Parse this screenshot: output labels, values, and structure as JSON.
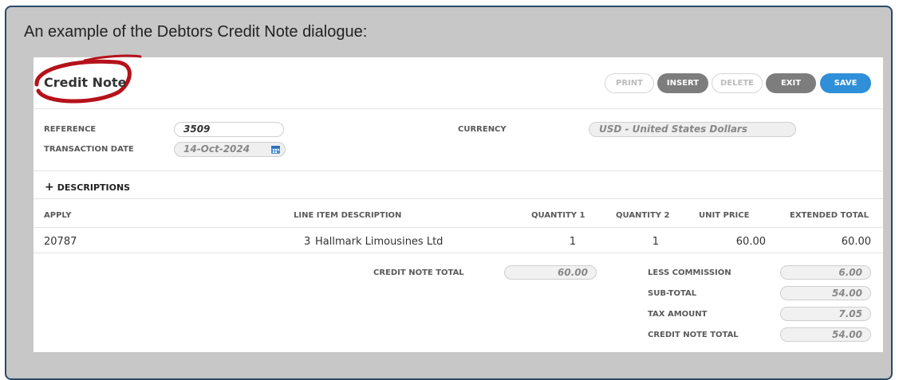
{
  "caption": "An example of the Debtors Credit Note dialogue:",
  "dialog": {
    "title": "Credit Note",
    "buttons": {
      "print": "PRINT",
      "insert": "INSERT",
      "delete": "DELETE",
      "exit": "EXIT",
      "save": "SAVE"
    }
  },
  "form": {
    "reference_label": "REFERENCE",
    "reference_value": "3509",
    "transaction_date_label": "TRANSACTION DATE",
    "transaction_date_value": "14-Oct-2024",
    "currency_label": "CURRENCY",
    "currency_value": "USD - United States Dollars"
  },
  "descriptions_toggle": {
    "icon": "+",
    "label": "DESCRIPTIONS"
  },
  "table": {
    "headers": {
      "apply": "APPLY",
      "line_item_description": "LINE ITEM DESCRIPTION",
      "quantity1": "QUANTITY 1",
      "quantity2": "QUANTITY 2",
      "unit_price": "UNIT PRICE",
      "extended_total": "EXTENDED TOTAL"
    },
    "rows": [
      {
        "apply": "20787",
        "line": "3",
        "description": "Hallmark Limousines Ltd",
        "quantity1": "1",
        "quantity2": "1",
        "unit_price": "60.00",
        "extended_total": "60.00"
      }
    ]
  },
  "totals": {
    "credit_note_total_label": "CREDIT NOTE TOTAL",
    "credit_note_total_value": "60.00",
    "less_commission_label": "LESS COMMISSION",
    "less_commission_value": "6.00",
    "subtotal_label": "SUB-TOTAL",
    "subtotal_value": "54.00",
    "tax_amount_label": "TAX AMOUNT",
    "tax_amount_value": "7.05",
    "final_total_label": "CREDIT NOTE TOTAL",
    "final_total_value": "54.00"
  },
  "colors": {
    "accent_blue": "#2f8fd8",
    "annotation_red": "#b5121b",
    "button_grey": "#7d7d7d"
  }
}
